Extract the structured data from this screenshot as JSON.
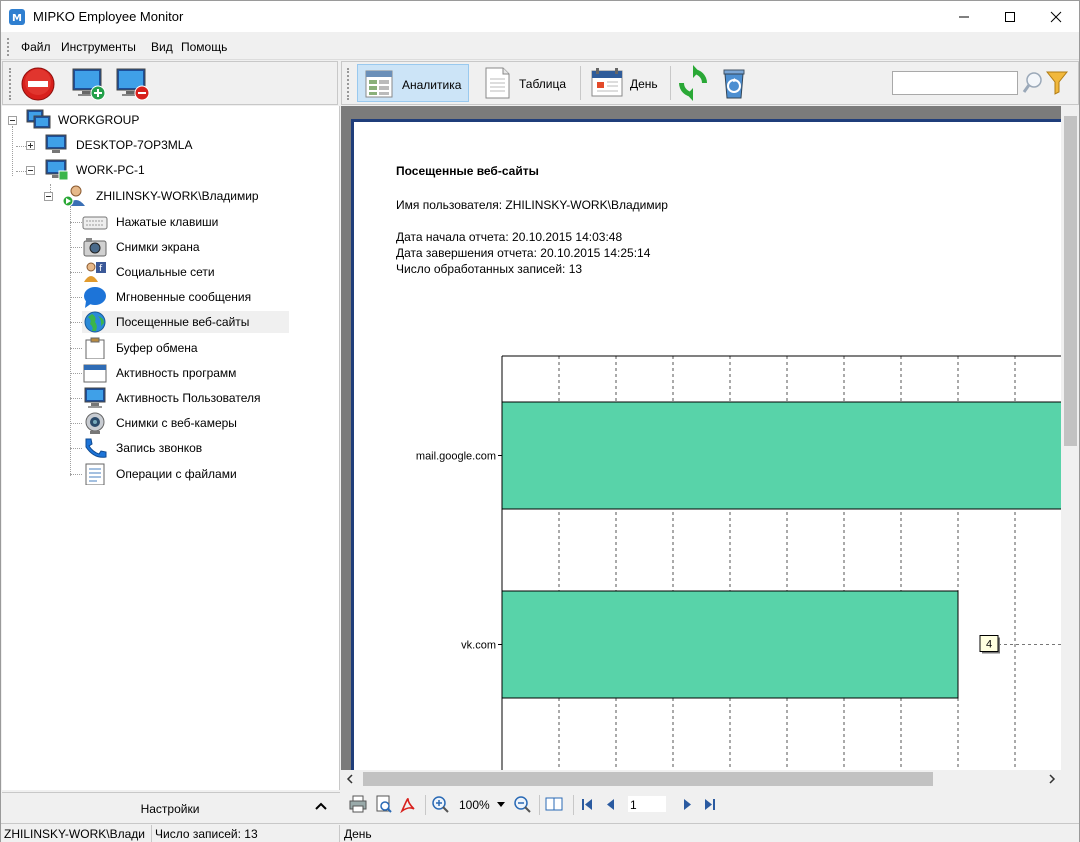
{
  "window": {
    "title": "MIPKO Employee Monitor"
  },
  "menu": {
    "items": [
      "Файл",
      "Инструменты",
      "Вид",
      "Помощь"
    ]
  },
  "toolbar": {
    "analytics_label": "Аналитика",
    "table_label": "Таблица",
    "day_label": "День",
    "search_value": ""
  },
  "tree": {
    "root": "WORKGROUP",
    "pc1": "DESKTOP-7OP3MLA",
    "pc2": "WORK-PC-1",
    "user": "ZHILINSKY-WORK\\Владимир",
    "items": [
      "Нажатые клавиши",
      "Снимки экрана",
      "Социальные сети",
      "Мгновенные сообщения",
      "Посещенные веб-сайты",
      "Буфер обмена",
      "Активность программ",
      "Активность Пользователя",
      "Снимки с веб-камеры",
      "Запись звонков",
      "Операции с файлами"
    ],
    "selected_index": 4
  },
  "settings_label": "Настройки",
  "report": {
    "title": "Посещенные веб-сайты",
    "user_line": "Имя пользователя: ZHILINSKY-WORK\\Владимир",
    "start_line": "Дата начала отчета: 20.10.2015 14:03:48",
    "end_line": "Дата завершения отчета: 20.10.2015 14:25:14",
    "count_line": "Число обработанных записей: 13"
  },
  "chart_data": {
    "type": "bar",
    "orientation": "horizontal",
    "categories": [
      "mail.google.com",
      "vk.com"
    ],
    "values": [
      5,
      4
    ],
    "data_labels": [
      "",
      "4"
    ],
    "grid": true,
    "colors": {
      "bar": "#58d3a9"
    }
  },
  "navbar": {
    "zoom": "100%",
    "page": "1"
  },
  "status": {
    "user": "ZHILINSKY-WORK\\Влади",
    "records": "Число записей: 13",
    "mode": "День"
  }
}
